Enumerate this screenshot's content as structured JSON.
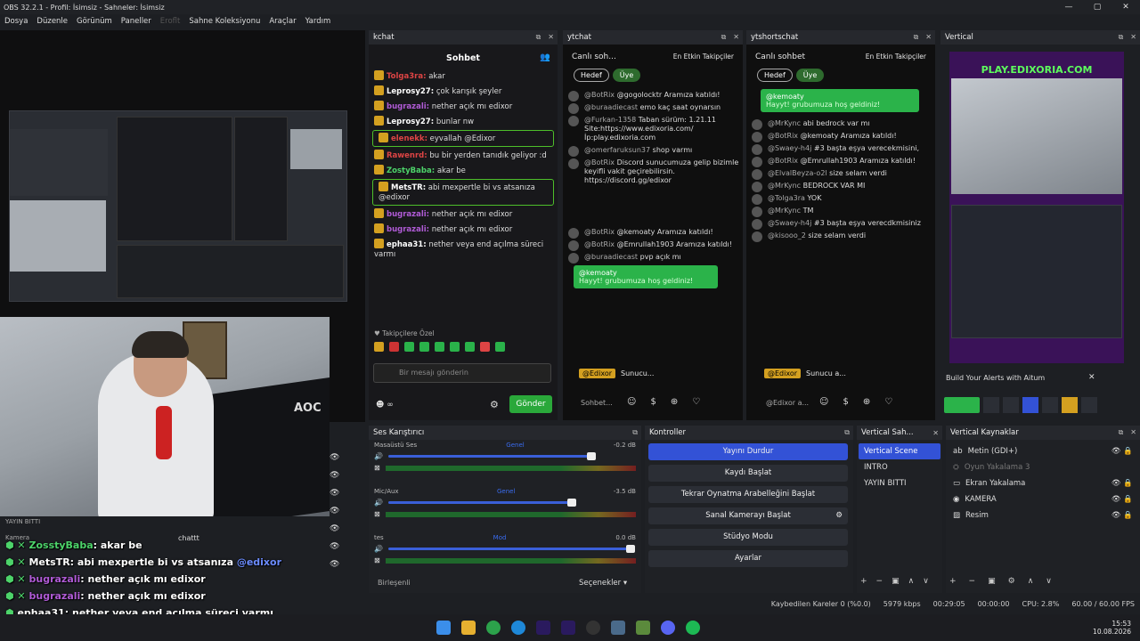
{
  "window": {
    "title": "OBS 32.2.1 - Profil: İsimsiz - Sahneler: İsimsiz"
  },
  "menu": [
    "Dosya",
    "Düzenle",
    "Görünüm",
    "Paneller",
    "Eroflt",
    "Sahne Koleksiyonu",
    "Araçlar",
    "Yardım"
  ],
  "kchat": {
    "dock_title": "kchat",
    "header": "Sohbet",
    "messages": [
      {
        "name": "Tolga3ra:",
        "text": "akar",
        "color": "#d44"
      },
      {
        "name": "Leprosy27:",
        "text": "çok karışık şeyler",
        "color": "#fff"
      },
      {
        "name": "bugrazali:",
        "text": "nether açık mı edixor",
        "color": "#b05bd6"
      },
      {
        "name": "Leprosy27:",
        "text": "bunlar nw",
        "color": "#fff"
      },
      {
        "name": "elenekk:",
        "text": "eyvallah @Edixor",
        "color": "#d44",
        "boxed": true
      },
      {
        "name": "Rawenrd:",
        "text": "bu bir yerden tanıdık geliyor :d",
        "color": "#d44"
      },
      {
        "name": "ZostyBaba:",
        "text": "akar be",
        "color": "#4dd36a"
      },
      {
        "name": "MetsTR:",
        "text": "abi mexpertle bi vs atsanıza @edixor",
        "color": "#fff",
        "boxed": true
      },
      {
        "name": "bugrazali:",
        "text": "nether açık mı edixor",
        "color": "#b05bd6"
      },
      {
        "name": "bugrazali:",
        "text": "nether açık mı edixor",
        "color": "#b05bd6"
      },
      {
        "name": "ephaa31:",
        "text": "nether veya end açılma süreci varmı",
        "color": "#fff"
      }
    ],
    "followers_label": "Takipçilere Özel",
    "input_placeholder": "Bir mesajı gönderin",
    "send_label": "Gönder"
  },
  "ytchat": {
    "dock_title": "ytchat",
    "header": "Canlı soh...",
    "top_label": "En Etkin Takipçiler",
    "pill_goal": "Hedef",
    "pill_member": "Üye",
    "messages": [
      {
        "name": "@BotRix",
        "text": "@gogolocktr Aramıza katıldı!"
      },
      {
        "name": "@buraadiecast",
        "text": "emo kaç saat oynarsın"
      },
      {
        "name": "@Furkan-1358",
        "text": "Taban sürüm: 1.21.11 Site:https://www.edixoria.com/ İp:play.edixoria.com"
      },
      {
        "name": "@omerfaruksun37",
        "text": "shop varmı"
      },
      {
        "name": "@BotRix",
        "text": "Discord sunucumuza gelip bizimle keyifli vakit geçirebilirsin. https://discord.gg/edixor"
      },
      {
        "name": "@BotRix",
        "text": "@kemoaty Aramıza katıldı!"
      },
      {
        "name": "@BotRix",
        "text": "@Emrullah1903 Aramıza katıldı!"
      },
      {
        "name": "@buraadiecast",
        "text": "pvp açık mı"
      }
    ],
    "green": {
      "name": "@kemoaty",
      "text": "Hayyt! grubumuza hoş geldiniz!"
    },
    "bottom_name": "@Edixor",
    "bottom_text": "Sunucu...",
    "input_placeholder": "Sohbet..."
  },
  "ytshortschat": {
    "dock_title": "ytshortschat",
    "header": "Canlı sohbet",
    "top_label": "En Etkin Takipçiler",
    "pill_goal": "Hedef",
    "pill_member": "Üye",
    "green": {
      "name": "@kemoaty",
      "text": "Hayyt! grubumuza hoş geldiniz!"
    },
    "messages": [
      {
        "name": "@MrKync",
        "text": "abi bedrock var mı"
      },
      {
        "name": "@BotRix",
        "text": "@kemoaty Aramıza katıldı!"
      },
      {
        "name": "@Swaey-h4j",
        "text": "#3  başta eşya verecekmisini,"
      },
      {
        "name": "@BotRix",
        "text": "@Emrullah1903 Aramıza katıldı!"
      },
      {
        "name": "@ElvalBeyza-o2l",
        "text": "size selam verdi"
      },
      {
        "name": "@MrKync",
        "text": "BEDROCK VAR MI"
      },
      {
        "name": "@Tolga3ra",
        "text": "YOK"
      },
      {
        "name": "@MrKync",
        "text": "TM"
      },
      {
        "name": "@Swaey-h4j",
        "text": "#3  başta eşya verecdkmisiniz"
      },
      {
        "name": "@kisooo_2",
        "text": "size selam verdi"
      }
    ],
    "bottom_name": "@Edixor",
    "bottom_text": "Sunucu a...",
    "input_placeholder": "@Edixor a..."
  },
  "vertical": {
    "dock_title": "Vertical",
    "url": "PLAY.EDIXORIA.COM",
    "alert_text": "Build Your Alerts with Aitum"
  },
  "mixer": {
    "title": "Ses Karıştırıcı",
    "tracks": [
      {
        "name": "Masaüstü Ses",
        "badge": "Genel",
        "db": "-0.2 dB",
        "level": 0.82
      },
      {
        "name": "Mic/Aux",
        "badge": "Genel",
        "db": "-3.5 dB",
        "level": 0.74
      },
      {
        "name": "tes",
        "badge": "Mod",
        "db": "0.0 dB",
        "level": 0.98
      }
    ],
    "ticks": [
      "-60",
      "-55",
      "-50",
      "-45",
      "-40",
      "-35",
      "-30",
      "-25",
      "-20",
      "-15",
      "-10",
      "-5",
      "0"
    ],
    "footer_left": "Birleşenli",
    "footer_right": "Seçenekler"
  },
  "controls": {
    "title": "Kontroller",
    "buttons": [
      "Yayını Durdur",
      "Kaydı Başlat",
      "Tekrar Oynatma Arabelleğini Başlat",
      "Sanal Kamerayı Başlat",
      "Stüdyo Modu",
      "Ayarlar"
    ]
  },
  "scenes": {
    "title": "Vertical Sah...",
    "items": [
      "Vertical Scene",
      "INTRO",
      "YAYIN BITTI"
    ]
  },
  "sources": {
    "title": "Vertical Kaynaklar",
    "items": [
      "Metin (GDI+)",
      "Oyun Yakalama 3",
      "Ekran Yakalama",
      "KAMERA",
      "Resim"
    ]
  },
  "overlay": {
    "lines": [
      {
        "name": "ZosstyBaba",
        "text": ": akar be",
        "color": "#4dd36a"
      },
      {
        "name": "MetsTR",
        "text": ": abi mexpertle bi vs atsanıza ",
        "mention": "@edixor",
        "color": "#fff"
      },
      {
        "name": "bugrazali",
        "text": ": nether açık mı edixor",
        "color": "#b05bd6"
      },
      {
        "name": "bugrazali",
        "text": ": nether açık mı edixor",
        "color": "#b05bd6"
      },
      {
        "name": "ephaa31",
        "text": ": nether veya end açılma süreci varmı",
        "color": "#fff"
      }
    ],
    "mini_scenes": [
      "YAYIN BITTI",
      "Kamera"
    ],
    "mini_source": "chattt"
  },
  "status": {
    "dropped": "Kaybedilen Kareler 0 (%0.0)",
    "bitrate": "5979 kbps",
    "time": "00:29:05",
    "rec": "00:00:00",
    "cpu": "CPU: 2.8%",
    "fps": "60.00 / 60.00 FPS"
  },
  "clock": {
    "time": "15:53",
    "date": "10.08.2026"
  },
  "colors": {
    "accent": "#3352d6",
    "green": "#2bb34a",
    "kick": "#53fc18"
  }
}
